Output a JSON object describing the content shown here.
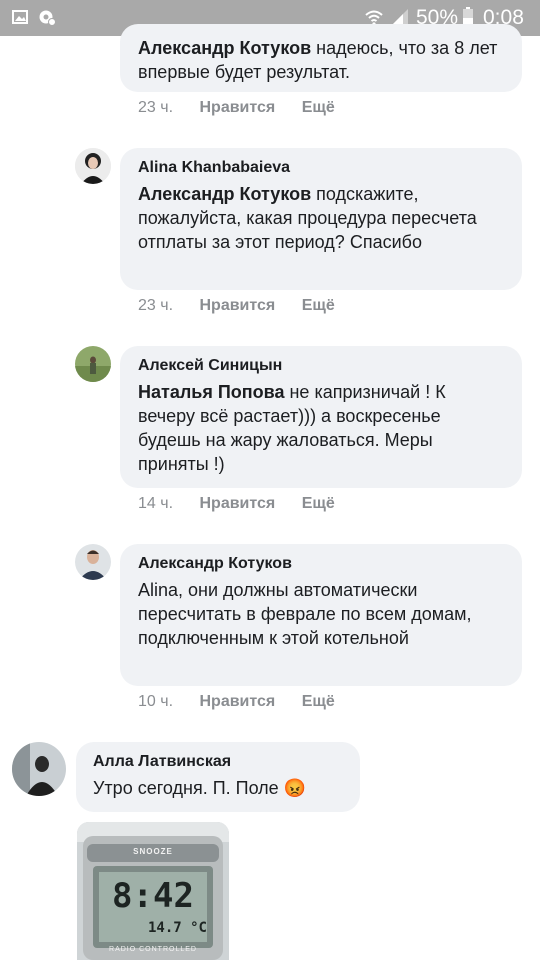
{
  "status_bar": {
    "battery_percent": "50%",
    "time": "0:08",
    "left_icons": [
      "image-icon",
      "settings-notification-icon"
    ],
    "right_icons": [
      "wifi-icon",
      "signal-icon",
      "battery-icon"
    ]
  },
  "comments": [
    {
      "author": "",
      "mention": "Александр Котуков",
      "text": " надеюсь, что за 8 лет впервые будет результат.",
      "time": "23 ч.",
      "like": "Нравится",
      "more": "Ещё"
    },
    {
      "author": "Alina Khanbabaieva",
      "mention": "Александр Котуков",
      "text": " подскажите, пожалуйста, какая процедура пересчета отплаты за этот период? Спасибо",
      "time": "23 ч.",
      "like": "Нравится",
      "more": "Ещё"
    },
    {
      "author": "Алексей Синицын",
      "mention": "Наталья Попова",
      "text": " не капризничай ! К вечеру всё растает))) а воскресенье будешь на жару жаловаться. Меры приняты !)",
      "time": "14 ч.",
      "like": "Нравится",
      "more": "Ещё"
    },
    {
      "author": "Александр Котуков",
      "mention": "",
      "text": "Alina, они должны автоматически пересчитать в феврале по всем домам, подключенным к этой котельной",
      "time": "10 ч.",
      "like": "Нравится",
      "more": "Ещё"
    },
    {
      "author": "Алла Латвинская",
      "mention": "",
      "text": "Утро сегодня. П. Поле ",
      "emoji": "😡"
    }
  ],
  "photo": {
    "brand": "SNOOZE",
    "clock_time": "8:42",
    "temperature": "14.7 °C",
    "label": "RADIO CONTROLLED"
  }
}
